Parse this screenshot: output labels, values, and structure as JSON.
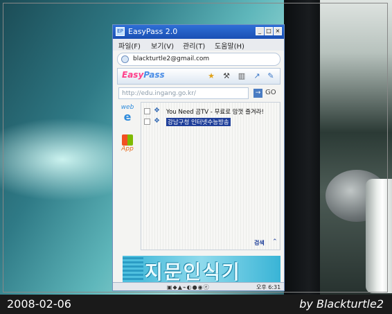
{
  "window": {
    "title": "EasyPass 2.0",
    "app_icon": "EP",
    "controls": [
      "_",
      "□",
      "×"
    ]
  },
  "menu": [
    "파일(F)",
    "보기(V)",
    "관리(T)",
    "도움말(H)"
  ],
  "account": {
    "email": "blackturtle2@gmail.com",
    "icon": "user-icon"
  },
  "toolbar": {
    "logo_easy": "Easy",
    "logo_pass": "Pass",
    "icons": [
      "star-icon",
      "hammer-icon",
      "trash-icon",
      "arrow-up-right-icon",
      "pin-icon"
    ]
  },
  "address": {
    "url": "http://edu.ingang.go.kr/",
    "go_label": "GO",
    "go_arrow": "→"
  },
  "side_tabs": [
    {
      "label": "web",
      "icon": "internet-explorer-icon"
    },
    {
      "label": "App",
      "icon": "windows-logo-icon"
    }
  ],
  "list": [
    {
      "text": "You Need 곰TV - 무료로 맘껏 즐겨라!",
      "selected": false
    },
    {
      "text": "강남구청 인터넷수능방송",
      "selected": true
    }
  ],
  "bottom": {
    "search_label": "검색",
    "collapse_symbol": "⌃"
  },
  "banner": {
    "text": "지문인식기"
  },
  "tray": {
    "time": "오후 6:31"
  },
  "caption": {
    "date": "2008-02-06",
    "author": "by Blackturtle2"
  },
  "colors": {
    "titlebar": "#1a4fb4",
    "selection": "#1f3f9a",
    "banner": "#39b4d6"
  }
}
